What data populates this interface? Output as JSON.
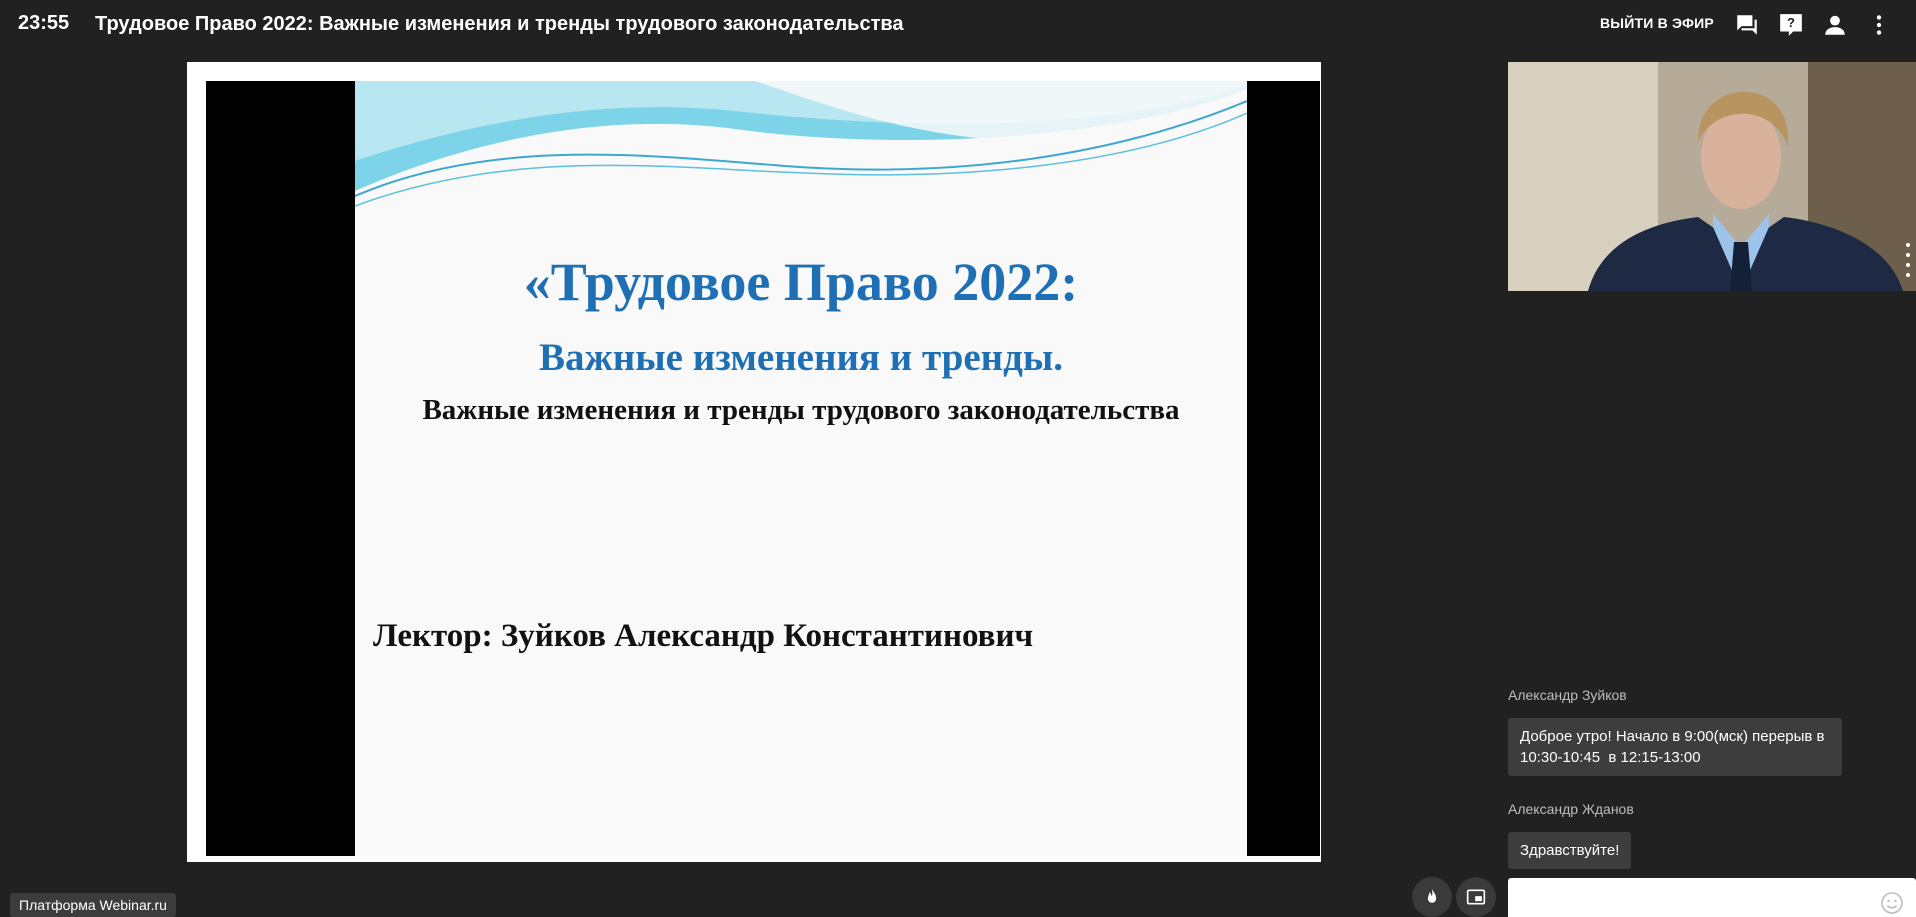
{
  "header": {
    "time": "23:55",
    "title": "Трудовое Право 2022: Важные изменения и тренды трудового законодательства",
    "exit_label": "ВЫЙТИ В ЭФИР",
    "icons": [
      "chat-icon",
      "help-icon",
      "person-icon",
      "more-vert-icon"
    ]
  },
  "slide": {
    "line1": "«Трудовое Право 2022:",
    "line2": "Важные изменения и тренды.",
    "line3": "Важные изменения и тренды трудового законодательства",
    "line4": "Лектор: Зуйков  Александр Константинович",
    "accent_color": "#1f6fb5"
  },
  "chat": {
    "messages": [
      {
        "author": "Александр Зуйков",
        "lines": [
          "Доброе утро! Начало в 9:00(мск) перерыв в",
          "10:30-10:45  в 12:15-13:00"
        ]
      },
      {
        "author": "Александр Жданов",
        "lines": [
          "Здравствуйте!"
        ]
      }
    ],
    "input_placeholder": ""
  },
  "controls": {
    "icons": [
      "flame-icon",
      "picture-in-picture-icon"
    ]
  },
  "footer": {
    "platform_label": "Платформа Webinar.ru"
  }
}
